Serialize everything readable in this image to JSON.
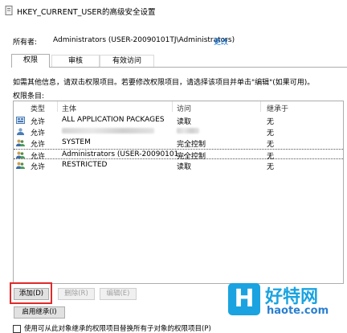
{
  "window": {
    "title": "HKEY_CURRENT_USER的高级安全设置",
    "icon": "registry-key-icon"
  },
  "owner": {
    "label": "所有者:",
    "value": "Administrators (USER-20090101TJ\\Administrators)",
    "change_link": "更改"
  },
  "tabs": [
    {
      "label": "权限",
      "active": true
    },
    {
      "label": "审核",
      "active": false
    },
    {
      "label": "有效访问",
      "active": false
    }
  ],
  "hint_text": "如需其他信息，请双击权限项目。若要修改权限项目，请选择该项目并单击\"编辑\"(如果可用)。",
  "entries_label": "权限条目:",
  "table": {
    "columns": [
      "类型",
      "主体",
      "访问",
      "继承于"
    ],
    "rows": [
      {
        "icon": "package-icon",
        "type": "允许",
        "principal": "ALL APPLICATION PACKAGES",
        "access": "读取",
        "inherited": "无",
        "blurred": false,
        "selected": false
      },
      {
        "icon": "user-icon",
        "type": "允许",
        "principal": "",
        "access": "",
        "inherited": "无",
        "blurred": true,
        "selected": false
      },
      {
        "icon": "user-group-icon",
        "type": "允许",
        "principal": "SYSTEM",
        "access": "完全控制",
        "inherited": "无",
        "blurred": false,
        "selected": false
      },
      {
        "icon": "user-group-icon",
        "type": "允许",
        "principal": "Administrators (USER-20090101...",
        "access": "完全控制",
        "inherited": "无",
        "blurred": false,
        "selected": true
      },
      {
        "icon": "user-group-icon",
        "type": "允许",
        "principal": "RESTRICTED",
        "access": "读取",
        "inherited": "无",
        "blurred": false,
        "selected": false
      }
    ]
  },
  "buttons": {
    "add": "添加(D)",
    "remove": "删除(R)",
    "edit": "编辑(E)",
    "enable_inheritance": "启用继承(I)"
  },
  "checkbox": {
    "label": "使用可从此对象继承的权限项目替换所有子对象的权限项目(P)",
    "checked": false
  },
  "watermark": {
    "name": "好特网",
    "url": "haote.com",
    "logo_letter": "H"
  },
  "colors": {
    "highlight": "#e02a2a",
    "link": "#0066cc",
    "watermark": "#1aa3e0"
  }
}
